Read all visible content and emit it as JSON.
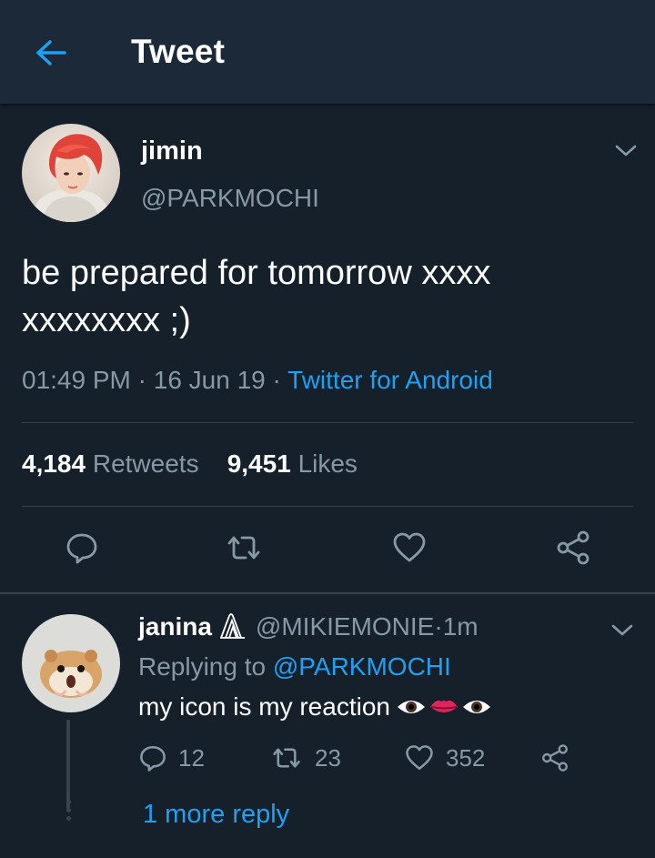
{
  "colors": {
    "background": "#15202b",
    "header": "#1c2938",
    "accent": "#1da1f2",
    "muted": "#8899a6",
    "divider": "#38444d"
  },
  "header": {
    "title": "Tweet",
    "back_icon": "arrow-left-icon"
  },
  "tweet": {
    "display_name": "jimin",
    "handle": "@PARKMOCHI",
    "text_line1": "be prepared for tomorrow xxxx",
    "text_line2": "xxxxxxxx ;)",
    "time": "01:49 PM",
    "date": "16 Jun 19",
    "source": "Twitter for Android",
    "separator": " · ",
    "retweets_count": "4,184",
    "retweets_label": "Retweets",
    "likes_count": "9,451",
    "likes_label": "Likes",
    "actions": [
      "reply-icon",
      "retweet-icon",
      "heart-icon",
      "share-icon"
    ]
  },
  "reply": {
    "display_name": "janina",
    "badge_icon": "paperclip-icon",
    "handle": "@MIKIEMONIE",
    "time": "1m",
    "replying_prefix": "Replying to",
    "replying_to": "@PARKMOCHI",
    "text": "my icon is my reaction",
    "emojis": [
      "eye-icon",
      "lips-icon",
      "eye-icon"
    ],
    "reply_count": "12",
    "retweet_count": "23",
    "like_count": "352",
    "more_replies": "1 more reply"
  }
}
